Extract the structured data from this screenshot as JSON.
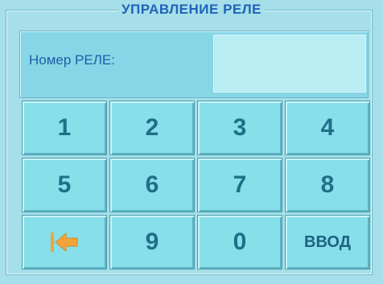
{
  "window": {
    "title": "УПРАВЛЕНИЕ РЕЛЕ"
  },
  "input": {
    "label": "Номер РЕЛЕ:",
    "value": ""
  },
  "keypad": {
    "k1": "1",
    "k2": "2",
    "k3": "3",
    "k4": "4",
    "k5": "5",
    "k6": "6",
    "k7": "7",
    "k8": "8",
    "k9": "9",
    "k0": "0",
    "backspace_icon": "backspace-arrow-icon",
    "enter": "ВВОД"
  },
  "colors": {
    "background": "#a6dfe9",
    "key": "#86dfe9",
    "text_blue": "#1e63b8",
    "digit": "#1f6f86",
    "arrow": "#f2a43a"
  }
}
